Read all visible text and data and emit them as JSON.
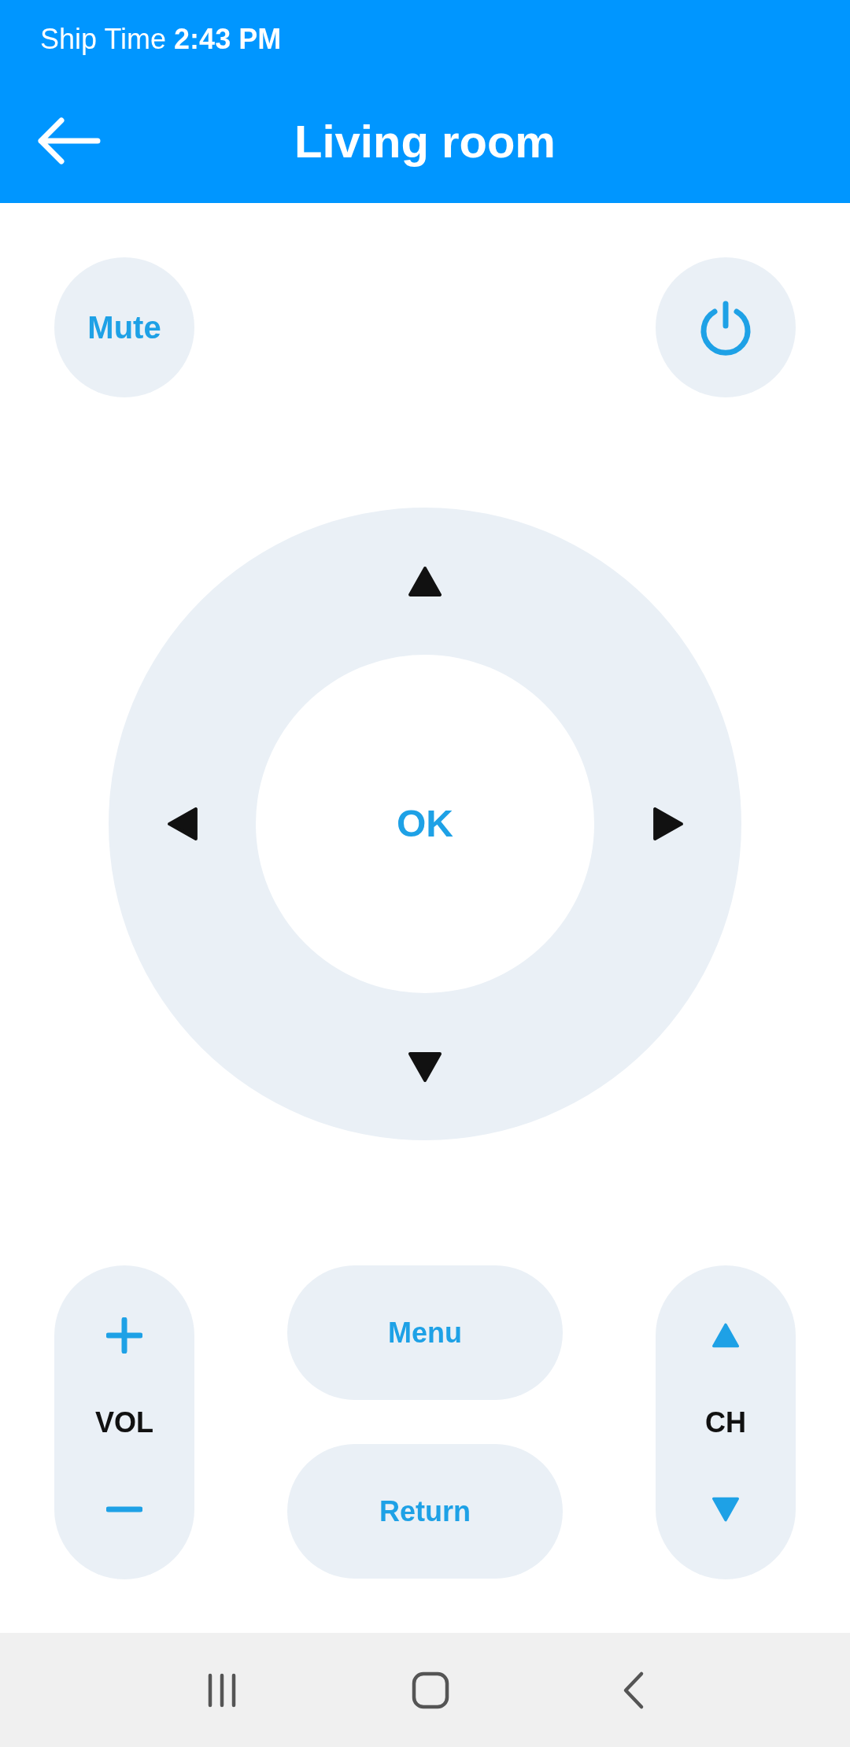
{
  "status_bar": {
    "label": "Ship Time",
    "time": "2:43 PM"
  },
  "header": {
    "title": "Living room"
  },
  "top_buttons": {
    "mute": "Mute"
  },
  "dpad": {
    "center": "OK"
  },
  "volume": {
    "label": "VOL"
  },
  "center_buttons": [
    "Menu",
    "Return"
  ],
  "channel": {
    "label": "CH"
  }
}
